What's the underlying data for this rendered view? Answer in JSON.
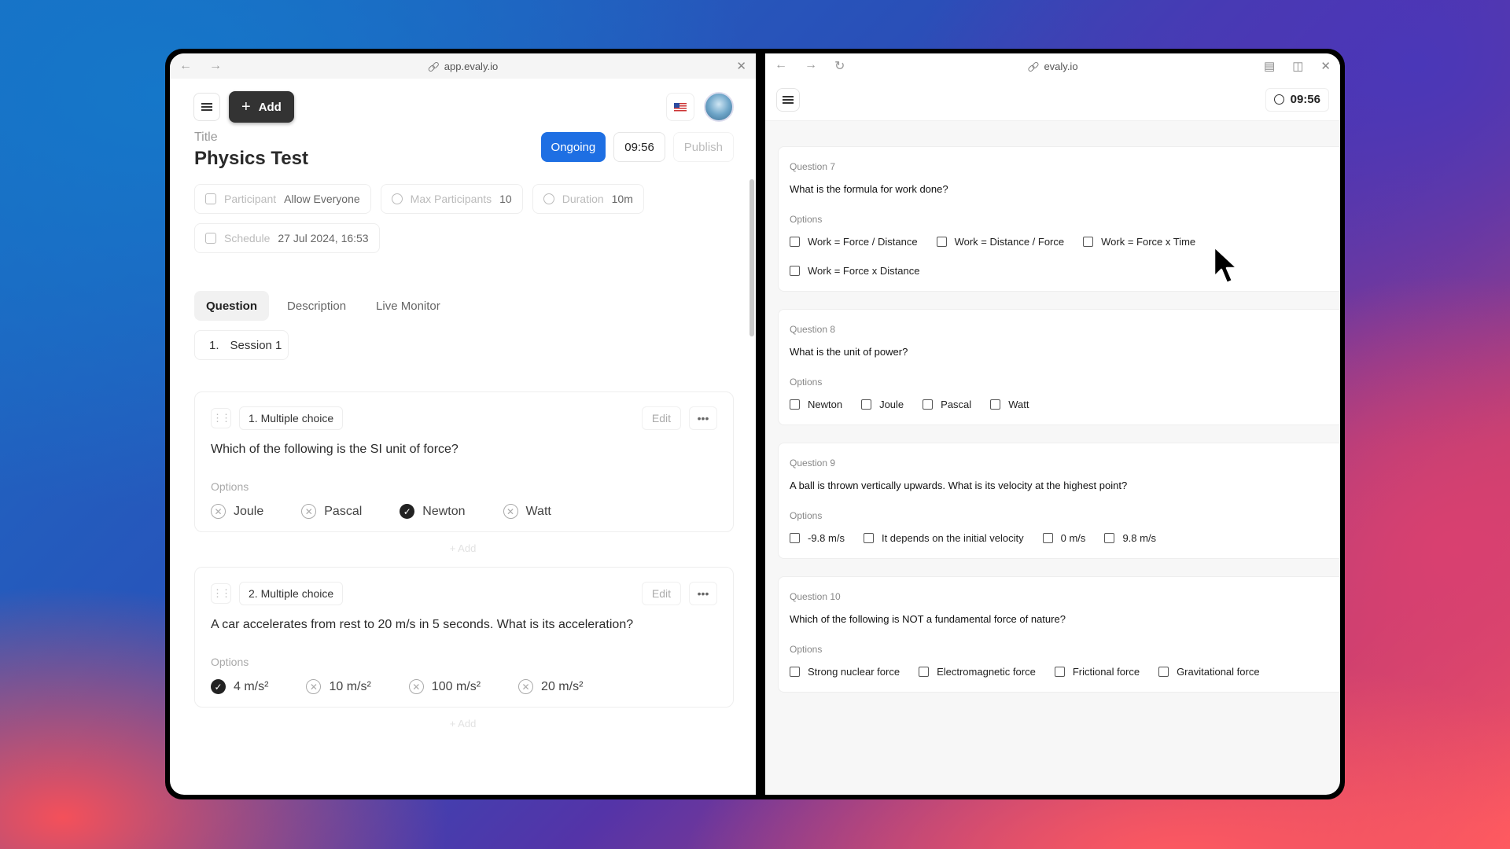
{
  "left_browser": {
    "url": "app.evaly.io",
    "add_label": "Add",
    "title_label": "Title",
    "title": "Physics Test",
    "status": "Ongoing",
    "timer": "09:56",
    "publish_label": "Publish",
    "meta": {
      "participant_key": "Participant",
      "participant_val": "Allow Everyone",
      "max_key": "Max Participants",
      "max_val": "10",
      "duration_key": "Duration",
      "duration_val": "10m",
      "schedule_key": "Schedule",
      "schedule_val": "27 Jul 2024, 16:53"
    },
    "tabs": [
      "Question",
      "Description",
      "Live Monitor"
    ],
    "session_num": "1.",
    "session_label": "Session 1",
    "edit_label": "Edit",
    "options_label": "Options",
    "add_between_label": "+ Add",
    "questions": [
      {
        "type": "1. Multiple choice",
        "text": "Which of the following is the SI unit of force?",
        "options": [
          "Joule",
          "Pascal",
          "Newton",
          "Watt"
        ],
        "correct_index": 2
      },
      {
        "type": "2. Multiple choice",
        "text": "A car accelerates from rest to 20 m/s in 5 seconds. What is its acceleration?",
        "options": [
          "4 m/s²",
          "10 m/s²",
          "100 m/s²",
          "20 m/s²"
        ],
        "correct_index": 0
      }
    ]
  },
  "right_browser": {
    "url": "evaly.io",
    "timer": "09:56",
    "options_label": "Options",
    "questions": [
      {
        "num": "Question 7",
        "text": "What is the formula for work done?",
        "options": [
          "Work = Force / Distance",
          "Work = Distance / Force",
          "Work = Force x Time",
          "Work = Force x Distance"
        ]
      },
      {
        "num": "Question 8",
        "text": "What is the unit of power?",
        "options": [
          "Newton",
          "Joule",
          "Pascal",
          "Watt"
        ]
      },
      {
        "num": "Question 9",
        "text": "A ball is thrown vertically upwards. What is its velocity at the highest point?",
        "options": [
          "-9.8 m/s",
          "It depends on the initial velocity",
          "0 m/s",
          "9.8 m/s"
        ]
      },
      {
        "num": "Question 10",
        "text": "Which of the following is NOT a fundamental force of nature?",
        "options": [
          "Strong nuclear force",
          "Electromagnetic force",
          "Frictional force",
          "Gravitational force"
        ]
      }
    ]
  },
  "colors": {
    "accent": "#1e6fe3",
    "button_dark": "#333333"
  }
}
